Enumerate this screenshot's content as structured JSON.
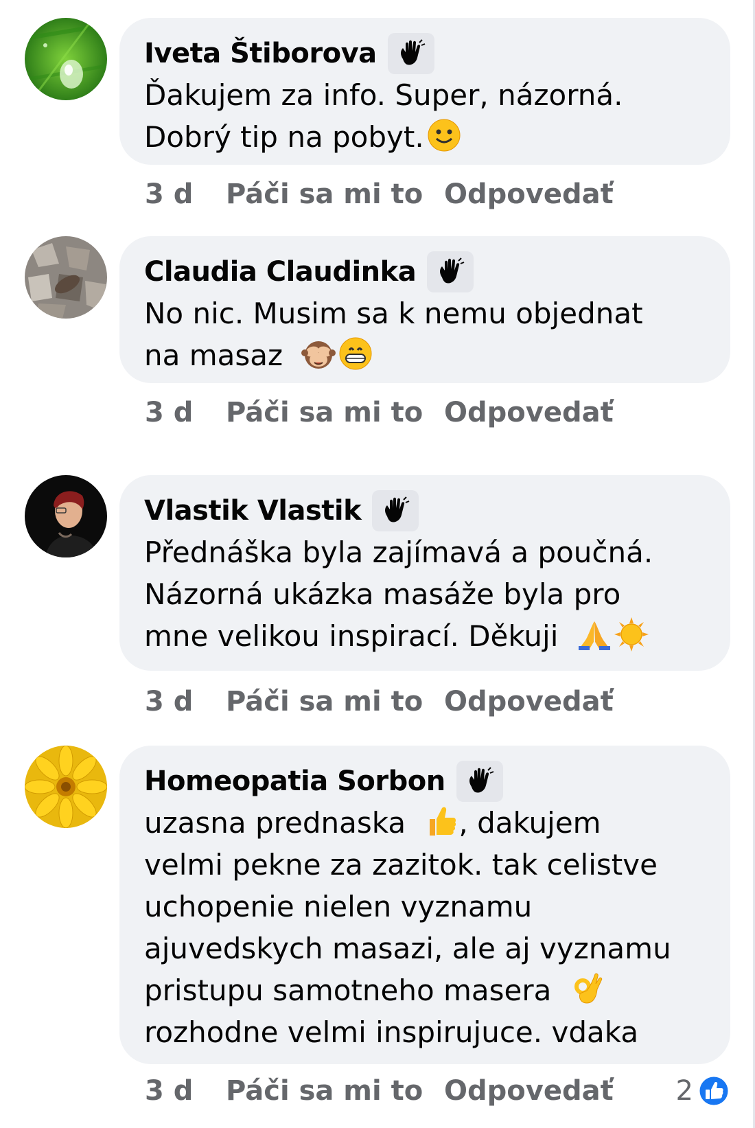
{
  "comments": [
    {
      "author": "Iveta Štiborova",
      "lines": [
        "Ďakujem za info. Super, názorná.",
        "Dobrý tip na pobyt."
      ],
      "time": "3 d",
      "like_label": "Páči sa mi to",
      "reply_label": "Odpovedať"
    },
    {
      "author": "Claudia Claudinka",
      "lines": [
        "No nic. Musim sa k nemu objednat",
        "na masaz"
      ],
      "time": "3 d",
      "like_label": "Páči sa mi to",
      "reply_label": "Odpovedať"
    },
    {
      "author": "Vlastik Vlastik",
      "lines": [
        "Přednáška byla zajímavá a poučná.",
        "Názorná ukázka masáže byla pro",
        "mne velikou inspirací. Děkuji"
      ],
      "time": "3 d",
      "like_label": "Páči sa mi to",
      "reply_label": "Odpovedať"
    },
    {
      "author": "Homeopatia Sorbon",
      "lines": [
        "uzasna prednaska",
        ", dakujem",
        "velmi pekne za zazitok. tak celistve",
        "uchopenie nielen vyznamu",
        "ajuvedskych masazi, ale aj vyznamu",
        "pristupu samotneho masera",
        "rozhodne velmi inspirujuce. vdaka"
      ],
      "time": "3 d",
      "like_label": "Páči sa mi to",
      "reply_label": "Odpovedať",
      "reaction_count": "2"
    }
  ],
  "icons": {
    "badge": "waving-hand-icon",
    "emoji_1": "slightly-smiling-face-icon",
    "emoji_2a": "see-no-evil-monkey-icon",
    "emoji_2b": "grinning-face-icon",
    "emoji_3a": "folded-hands-icon",
    "emoji_3b": "sun-icon",
    "emoji_4a": "thumbs-up-icon",
    "emoji_4b": "ok-hand-icon",
    "reaction": "like-reaction-icon"
  },
  "colors": {
    "bubble": "#f0f2f5",
    "meta_text": "#65676b",
    "like_blue": "#1877f2"
  }
}
